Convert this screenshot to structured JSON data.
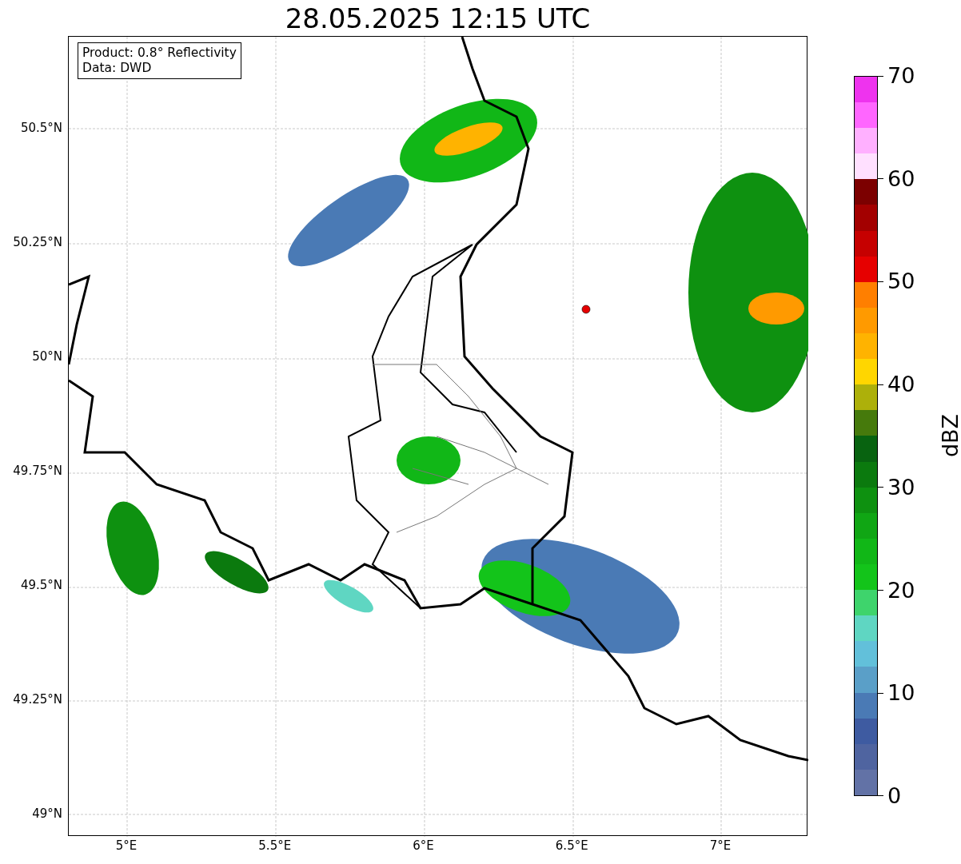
{
  "title": "28.05.2025 12:15 UTC",
  "info_box": [
    "Product: 0.8° Reflectivity",
    "Data: DWD"
  ],
  "y_ticks": [
    "50.5°N",
    "50.25°N",
    "50°N",
    "49.75°N",
    "49.5°N",
    "49.25°N",
    "49°N"
  ],
  "x_ticks": [
    "5°E",
    "5.5°E",
    "6°E",
    "6.5°E",
    "7°E"
  ],
  "colorbar": {
    "label": "dBZ",
    "ticks": [
      "70",
      "60",
      "50",
      "40",
      "30",
      "20",
      "10",
      "0"
    ],
    "segments": [
      {
        "color": "#6272a6"
      },
      {
        "color": "#4f64a0"
      },
      {
        "color": "#3e5ba1"
      },
      {
        "color": "#4a7ab5"
      },
      {
        "color": "#5a9fc8"
      },
      {
        "color": "#62c0da"
      },
      {
        "color": "#5fd6c2"
      },
      {
        "color": "#3ed46c"
      },
      {
        "color": "#13c41a"
      },
      {
        "color": "#11b717"
      },
      {
        "color": "#10a614"
      },
      {
        "color": "#0e9110"
      },
      {
        "color": "#0b7a0e"
      },
      {
        "color": "#086310"
      },
      {
        "color": "#467a0c"
      },
      {
        "color": "#adb00a"
      },
      {
        "color": "#ffd600"
      },
      {
        "color": "#ffb300"
      },
      {
        "color": "#ff9a00"
      },
      {
        "color": "#ff7f00"
      },
      {
        "color": "#e60000"
      },
      {
        "color": "#c60000"
      },
      {
        "color": "#a30000"
      },
      {
        "color": "#7c0000"
      },
      {
        "color": "#ffe0ff"
      },
      {
        "color": "#ffb0ff"
      },
      {
        "color": "#ff66ff"
      },
      {
        "color": "#ee33ee"
      }
    ]
  }
}
